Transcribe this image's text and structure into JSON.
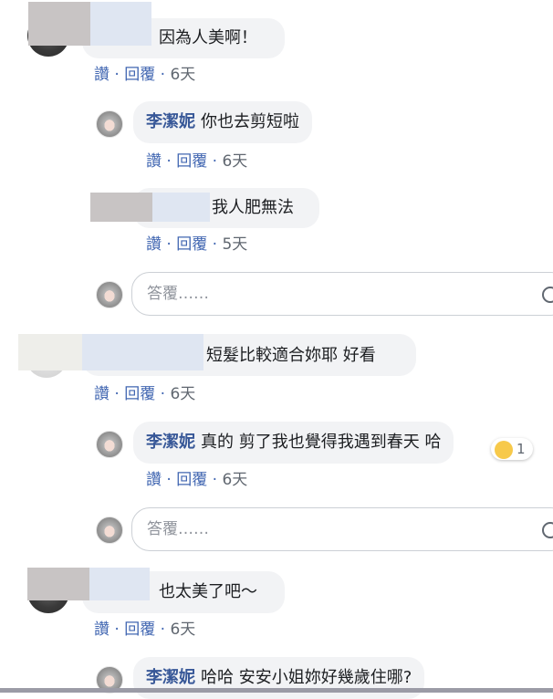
{
  "ui": {
    "like": "讚",
    "reply": "回覆",
    "reply_placeholder": "答覆……"
  },
  "comments": [
    {
      "text": "因為人美啊！",
      "time": "6天"
    },
    {
      "name": "李潔妮",
      "text": "你也去剪短啦",
      "time": "6天"
    },
    {
      "text": "我人肥無法",
      "time": "5天"
    },
    {
      "text": "短髮比較適合妳耶 好看",
      "time": "6天"
    },
    {
      "name": "李潔妮",
      "text": "真的 剪了我也覺得我遇到春天 哈",
      "time": "6天",
      "reaction_count": "1"
    },
    {
      "text": "也太美了吧～",
      "time": "6天"
    },
    {
      "name": "李潔妮",
      "text": "哈哈 安安小姐妳好幾歲住哪?"
    }
  ],
  "colors": {
    "link_blue": "#4267b2",
    "name_blue": "#385898",
    "bubble_bg": "#f2f3f5"
  }
}
